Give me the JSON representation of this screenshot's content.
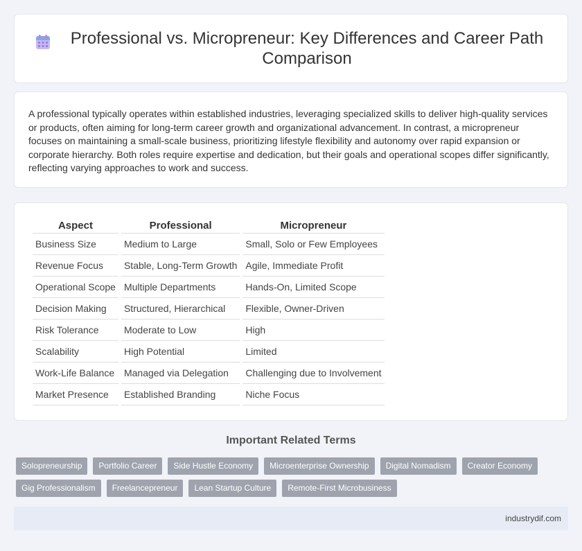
{
  "header": {
    "title": "Professional vs. Micropreneur: Key Differences and Career Path Comparison",
    "icon": "calendar-icon"
  },
  "intro": {
    "text": "A professional typically operates within established industries, leveraging specialized skills to deliver high-quality services or products, often aiming for long-term career growth and organizational advancement. In contrast, a micropreneur focuses on maintaining a small-scale business, prioritizing lifestyle flexibility and autonomy over rapid expansion or corporate hierarchy. Both roles require expertise and dedication, but their goals and operational scopes differ significantly, reflecting varying approaches to work and success."
  },
  "table": {
    "headers": [
      "Aspect",
      "Professional",
      "Micropreneur"
    ],
    "rows": [
      [
        "Business Size",
        "Medium to Large",
        "Small, Solo or Few Employees"
      ],
      [
        "Revenue Focus",
        "Stable, Long-Term Growth",
        "Agile, Immediate Profit"
      ],
      [
        "Operational Scope",
        "Multiple Departments",
        "Hands-On, Limited Scope"
      ],
      [
        "Decision Making",
        "Structured, Hierarchical",
        "Flexible, Owner-Driven"
      ],
      [
        "Risk Tolerance",
        "Moderate to Low",
        "High"
      ],
      [
        "Scalability",
        "High Potential",
        "Limited"
      ],
      [
        "Work-Life Balance",
        "Managed via Delegation",
        "Challenging due to Involvement"
      ],
      [
        "Market Presence",
        "Established Branding",
        "Niche Focus"
      ]
    ]
  },
  "related": {
    "title": "Important Related Terms",
    "tags": [
      "Solopreneurship",
      "Portfolio Career",
      "Side Hustle Economy",
      "Microenterprise Ownership",
      "Digital Nomadism",
      "Creator Economy",
      "Gig Professionalism",
      "Freelancepreneur",
      "Lean Startup Culture",
      "Remote-First Microbusiness"
    ]
  },
  "footer": {
    "site": "industrydif.com"
  },
  "colors": {
    "tag_bg": "#9ea3ad",
    "footer_bg": "#e6ebf5",
    "page_bg": "#f1f3f9"
  }
}
